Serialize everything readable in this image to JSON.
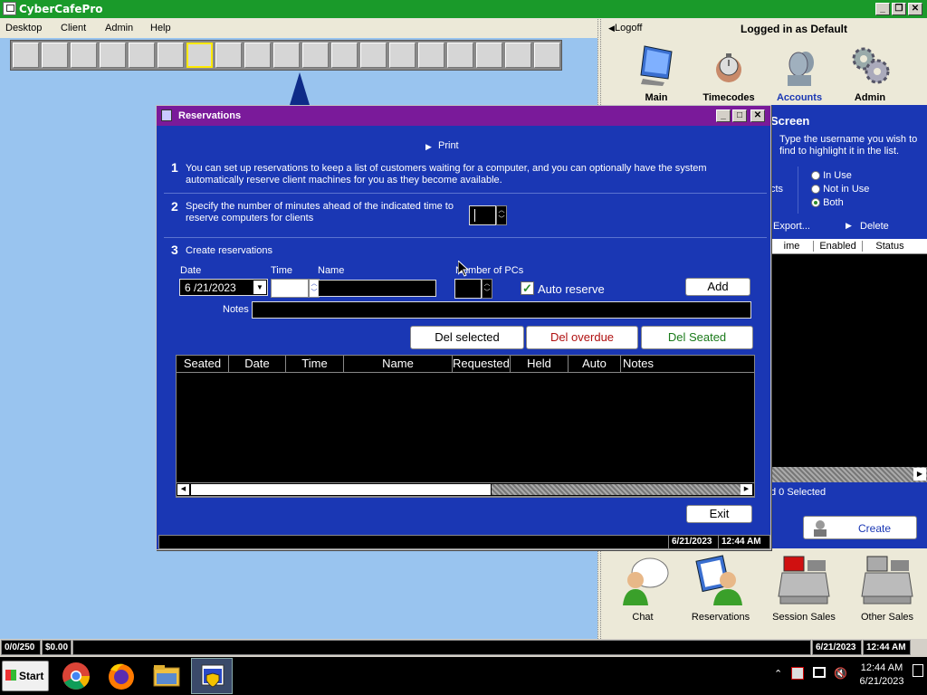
{
  "app": {
    "title": "CyberCafePro"
  },
  "menubar": {
    "items": [
      "Desktop",
      "Client",
      "Admin",
      "Help"
    ]
  },
  "right_panel": {
    "logoff": "Logoff",
    "logged_in": "Logged in as Default",
    "tools": [
      {
        "label": "Main",
        "icon": "monitor-icon"
      },
      {
        "label": "Timecodes",
        "icon": "stopwatch-icon"
      },
      {
        "label": "Accounts",
        "icon": "people-heads-icon"
      },
      {
        "label": "Admin",
        "icon": "gears-icon"
      }
    ],
    "screen_title": "Screen",
    "screen_hint": "Type the username you wish to find to highlight it in the list.",
    "cts": "cts",
    "radios": [
      "In Use",
      "Not in Use",
      "Both"
    ],
    "export": "Export...",
    "delete": "Delete",
    "table_headers": [
      "ime",
      "Enabled",
      "Status"
    ],
    "selected": "d 0 Selected",
    "create": "Create",
    "bottom_tools": [
      {
        "label": "Chat",
        "icon": "chat-icon"
      },
      {
        "label": "Reservations",
        "icon": "reservations-icon"
      },
      {
        "label": "Session Sales",
        "icon": "cash-register-icon"
      },
      {
        "label": "Other Sales",
        "icon": "cash-register-icon"
      }
    ]
  },
  "reservations": {
    "title": "Reservations",
    "print": "Print",
    "step1_num": "1",
    "step1_text": "You can set up reservations to keep a list of customers waiting for a computer, and you can optionally have the system automatically reserve client machines for you as they become available.",
    "step2_num": "2",
    "step2_text": "Specify the number of minutes ahead of the indicated time to reserve computers for clients",
    "step3_num": "3",
    "step3_text": "Create reservations",
    "labels": {
      "date": "Date",
      "time": "Time",
      "name": "Name",
      "num_pcs": "Number of PCs",
      "notes": "Notes"
    },
    "date_value": "6 /21/2023",
    "auto_reserve": "Auto reserve",
    "auto_reserve_checked": true,
    "add": "Add",
    "del_selected": "Del selected",
    "del_overdue": "Del overdue",
    "del_seated": "Del Seated",
    "columns": [
      "Seated",
      "Date",
      "Time",
      "Name",
      "Requested",
      "Held",
      "Auto",
      "Notes"
    ],
    "exit": "Exit",
    "status_date": "6/21/2023",
    "status_time": "12:44 AM"
  },
  "statusbar": {
    "count": "0/0/250",
    "money": "$0.00",
    "date": "6/21/2023",
    "time": "12:44 AM"
  },
  "taskbar": {
    "start": "Start",
    "clock_time": "12:44 AM",
    "clock_date": "6/21/2023"
  },
  "colors": {
    "window_blue": "#1a37b4",
    "title_purple": "#7a1a9a",
    "app_green": "#1a9a2a",
    "desktop": "#99c4ef"
  }
}
